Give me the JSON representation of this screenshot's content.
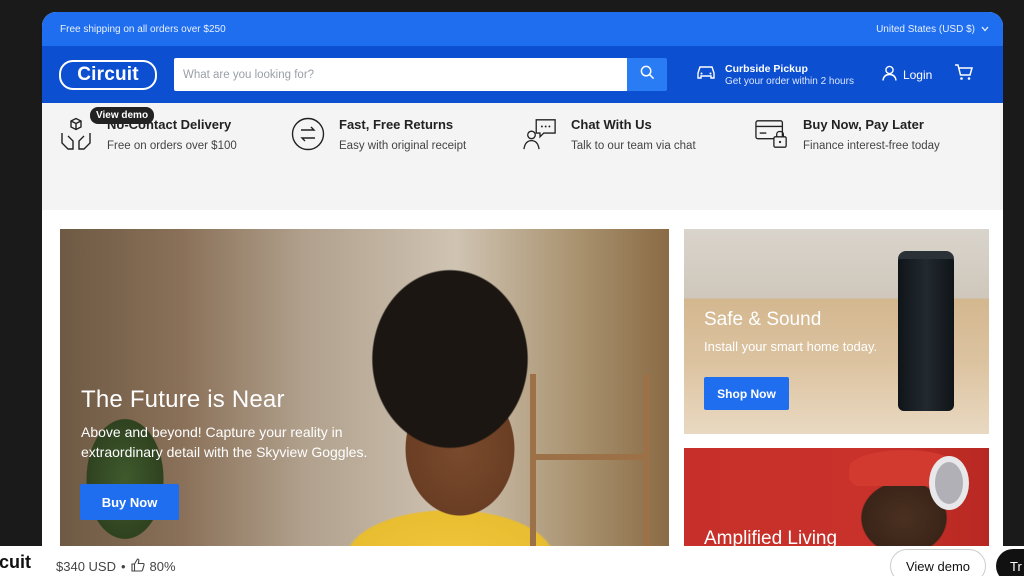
{
  "announcement": {
    "shipping_text": "Free shipping on all orders over $250",
    "country_selector": "United States (USD $)"
  },
  "header": {
    "logo_text": "Circuit",
    "search_placeholder": "What are you looking for?",
    "curbside_title": "Curbside Pickup",
    "curbside_subtitle": "Get your order within 2 hours",
    "login_label": "Login"
  },
  "features": {
    "demo_tooltip": "View demo",
    "items": [
      {
        "title": "No-Contact Delivery",
        "subtitle": "Free on orders over $100",
        "icon": "hands-box-icon"
      },
      {
        "title": "Fast, Free Returns",
        "subtitle": "Easy with original receipt",
        "icon": "exchange-arrows-icon"
      },
      {
        "title": "Chat With Us",
        "subtitle": "Talk to our team via chat",
        "icon": "chat-person-icon"
      },
      {
        "title": "Buy Now, Pay Later",
        "subtitle": "Finance interest-free today",
        "icon": "card-lock-icon"
      }
    ]
  },
  "hero": {
    "title": "The Future is Near",
    "subtitle": "Above and beyond! Capture your reality in extraordinary detail with the Skyview Goggles.",
    "button": "Buy Now"
  },
  "promo_speaker": {
    "title": "Safe & Sound",
    "subtitle": "Install your smart home today.",
    "button": "Shop Now"
  },
  "promo_headphones": {
    "title": "Amplified Living"
  },
  "bottom_bar": {
    "theme_name": "rcuit",
    "price": "$340 USD",
    "separator": "•",
    "rating": "80%",
    "view_demo": "View demo",
    "try_label": "Tr"
  },
  "colors": {
    "announce_blue": "#1f6ef0",
    "header_blue": "#0d4fd1",
    "button_blue": "#1f6ef0"
  }
}
